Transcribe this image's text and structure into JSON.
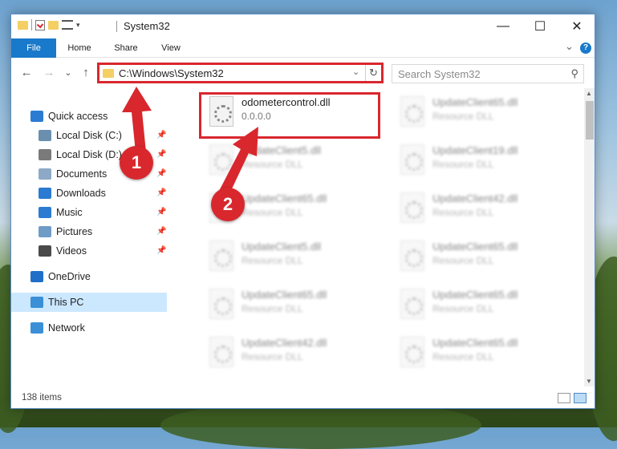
{
  "window": {
    "title": "System32",
    "minimize_glyph": "—",
    "maximize_glyph": "☐",
    "close_glyph": "✕"
  },
  "ribbon": {
    "tabs": [
      "File",
      "Home",
      "Share",
      "View"
    ],
    "expand_glyph": "⌄",
    "help_glyph": "?"
  },
  "address": {
    "path": "C:\\Windows\\System32",
    "dropdown_glyph": "⌄",
    "refresh_glyph": "↻",
    "back_glyph": "←",
    "forward_glyph": "→",
    "recent_glyph": "⌄",
    "up_glyph": "↑"
  },
  "search": {
    "placeholder": "Search System32",
    "icon_glyph": "⚲"
  },
  "nav": {
    "items": [
      {
        "label": "Quick access",
        "icon": "star-icon",
        "color": "#2b7bd2",
        "pinned": false
      },
      {
        "label": "Local Disk (C:)",
        "icon": "drive-icon",
        "color": "#6b8fae",
        "pinned": true
      },
      {
        "label": "Local Disk (D:)",
        "icon": "drive-icon",
        "color": "#7a7a7a",
        "pinned": true
      },
      {
        "label": "Documents",
        "icon": "documents-icon",
        "color": "#8ea9c8",
        "pinned": true
      },
      {
        "label": "Downloads",
        "icon": "download-icon",
        "color": "#2b7bd2",
        "pinned": true
      },
      {
        "label": "Music",
        "icon": "music-icon",
        "color": "#2b7bd2",
        "pinned": true
      },
      {
        "label": "Pictures",
        "icon": "pictures-icon",
        "color": "#6f9cc7",
        "pinned": true
      },
      {
        "label": "Videos",
        "icon": "videos-icon",
        "color": "#4a4a4a",
        "pinned": true
      },
      {
        "label": "OneDrive",
        "icon": "cloud-icon",
        "color": "#1f6fc9",
        "pinned": false
      },
      {
        "label": "This PC",
        "icon": "computer-icon",
        "color": "#3a8fd6",
        "pinned": false,
        "selected": true
      },
      {
        "label": "Network",
        "icon": "network-icon",
        "color": "#3a8fd6",
        "pinned": false
      }
    ],
    "pin_glyph": "📌"
  },
  "files": {
    "highlighted": {
      "name": "odometercontrol.dll",
      "type": "0.0.0.0"
    },
    "left_column": [
      {
        "name": "UpdateClient5.dll",
        "type": "Resource DLL"
      },
      {
        "name": "UpdateClient65.dll",
        "type": "Resource DLL"
      },
      {
        "name": "UpdateClient5.dll",
        "type": "Resource DLL"
      },
      {
        "name": "UpdateClient65.dll",
        "type": "Resource DLL"
      },
      {
        "name": "UpdateClient42.dll",
        "type": "Resource DLL"
      }
    ],
    "right_column": [
      {
        "name": "UpdateClient65.dll",
        "type": "Resource DLL"
      },
      {
        "name": "UpdateClient19.dll",
        "type": "Resource DLL"
      },
      {
        "name": "UpdateClient42.dll",
        "type": "Resource DLL"
      },
      {
        "name": "UpdateClient65.dll",
        "type": "Resource DLL"
      },
      {
        "name": "UpdateClient65.dll",
        "type": "Resource DLL"
      },
      {
        "name": "UpdateClient65.dll",
        "type": "Resource DLL"
      }
    ]
  },
  "status": {
    "item_count": "138 items"
  },
  "annotations": {
    "marker1": "1",
    "marker2": "2",
    "color": "#d9272e"
  }
}
